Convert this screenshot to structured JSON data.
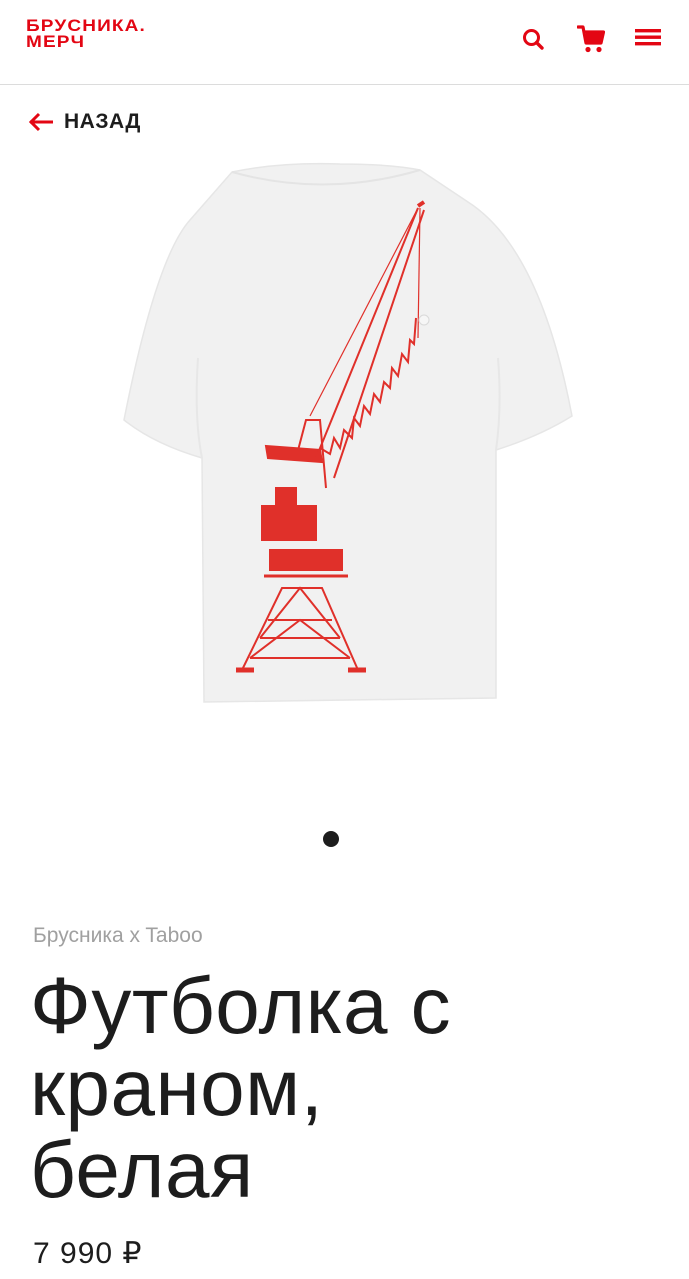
{
  "header": {
    "logo_line1": "БРУСНИКА.",
    "logo_line2": "МЕРЧ",
    "icons": [
      "search-icon",
      "cart-icon",
      "menu-icon"
    ],
    "accent_color": "#e30613"
  },
  "nav": {
    "back_label": "НАЗАД",
    "back_icon": "arrow-left-icon"
  },
  "gallery": {
    "image_alt": "Футболка с краном, белая",
    "active_slide": 1,
    "dot_count": 1
  },
  "product": {
    "brand": "Брусника x Taboo",
    "title_line1": "Футболка с",
    "title_line2": "краном,",
    "title_line3": "белая",
    "price": "7 990 ₽"
  }
}
